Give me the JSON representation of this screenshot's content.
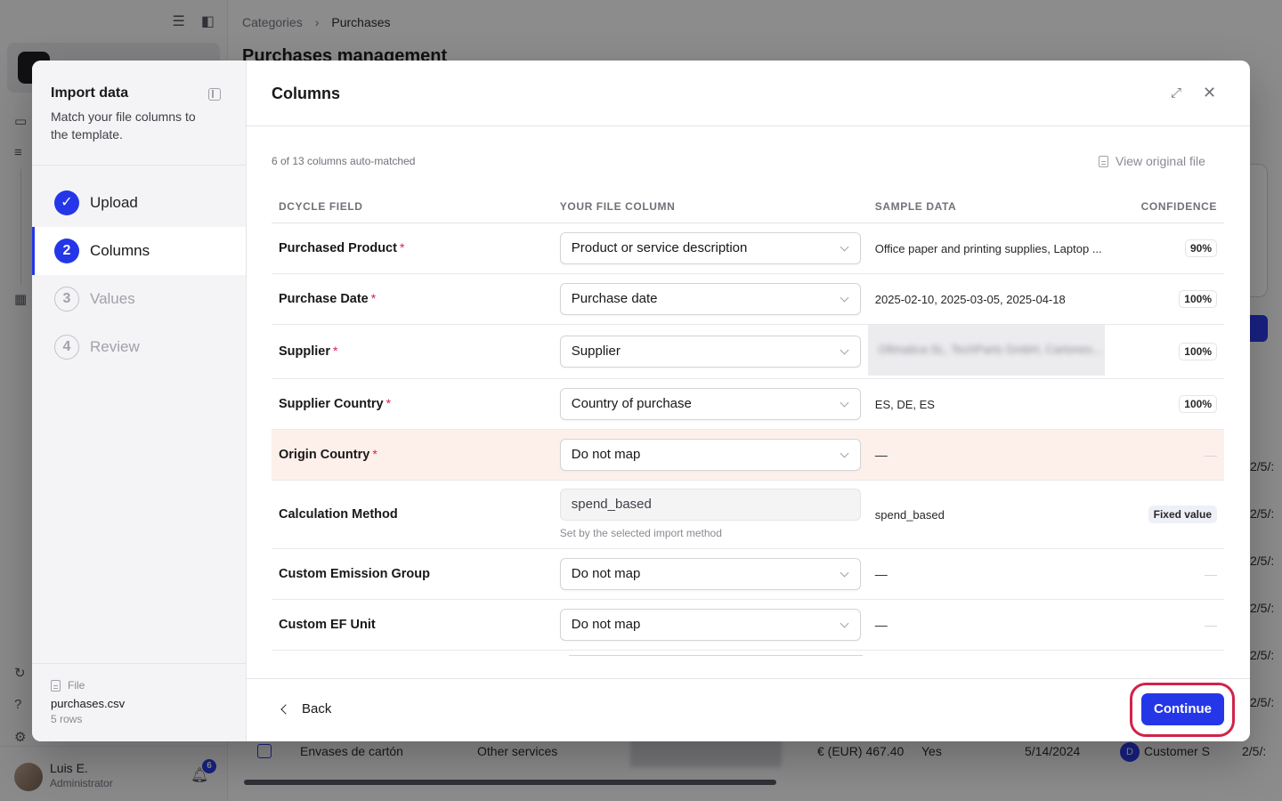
{
  "background": {
    "breadcrumb": {
      "parent": "Categories",
      "current": "Purchases"
    },
    "page_title": "Purchases management",
    "user": {
      "name": "Luis E.",
      "role": "Administrator",
      "notifications": "6"
    },
    "row": {
      "name": "Envases de cartón",
      "category": "Other services",
      "amount": "€ (EUR) 467.40",
      "flag": "Yes",
      "date": "5/14/2024",
      "customer": "Customer S",
      "date2": "2/5/:"
    },
    "right_dates": [
      "2/5/:",
      "2/5/:",
      "2/5/:",
      "2/5/:",
      "2/5/:",
      "2/5/:"
    ]
  },
  "import": {
    "title": "Import data",
    "subtitle": "Match your file columns to the template.",
    "steps": [
      {
        "num": "✓",
        "label": "Upload"
      },
      {
        "num": "2",
        "label": "Columns"
      },
      {
        "num": "3",
        "label": "Values"
      },
      {
        "num": "4",
        "label": "Review"
      }
    ],
    "file": {
      "label": "File",
      "name": "purchases.csv",
      "rows": "5 rows"
    }
  },
  "columns": {
    "title": "Columns",
    "auto_matched": "6 of 13 columns auto-matched",
    "view_original": "View original file",
    "headers": {
      "field": "DCYCLE FIELD",
      "column": "YOUR FILE COLUMN",
      "sample": "SAMPLE DATA",
      "confidence": "CONFIDENCE"
    },
    "rows": [
      {
        "field": "Purchased Product",
        "required": "*",
        "column": "Product or service description",
        "sample": "Office paper and printing supplies, Laptop ...",
        "confidence": "90%"
      },
      {
        "field": "Purchase Date",
        "required": "*",
        "column": "Purchase date",
        "sample": "2025-02-10, 2025-03-05, 2025-04-18",
        "confidence": "100%"
      },
      {
        "field": "Supplier",
        "required": "*",
        "column": "Supplier",
        "sample": "Ofimatica SL, TechParts GmbH, Cartones...",
        "confidence": "100%"
      },
      {
        "field": "Supplier Country",
        "required": "*",
        "column": "Country of purchase",
        "sample": "ES, DE, ES",
        "confidence": "100%"
      },
      {
        "field": "Origin Country",
        "required": "*",
        "column": "Do not map",
        "sample": "—",
        "confidence": "—"
      },
      {
        "field": "Calculation Method",
        "column": "spend_based",
        "hint": "Set by the selected import method",
        "sample": "spend_based",
        "confidence": "Fixed value"
      },
      {
        "field": "Custom Emission Group",
        "column": "Do not map",
        "sample": "—",
        "confidence": "—"
      },
      {
        "field": "Custom EF Unit",
        "column": "Do not map",
        "sample": "—",
        "confidence": "—"
      }
    ],
    "back_label": "Back",
    "continue_label": "Continue"
  }
}
